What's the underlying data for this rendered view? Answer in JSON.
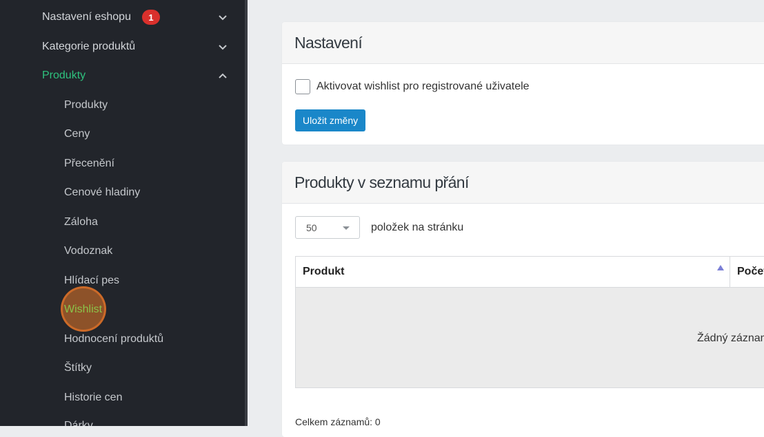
{
  "sidebar": {
    "top_items": [
      {
        "label": "Nastavení eshopu",
        "badge": "1"
      },
      {
        "label": "Kategorie produktů"
      },
      {
        "label": "Produkty"
      }
    ],
    "sub_items": [
      "Produkty",
      "Ceny",
      "Přecenění",
      "Cenové hladiny",
      "Záloha",
      "Vodoznak",
      "Hlídací pes",
      "Wishlist",
      "Hodnocení produktů",
      "Štítky",
      "Historie cen",
      "Dárky"
    ],
    "active_color": "#2ec27e",
    "badge_color": "#d9302c"
  },
  "settings_card": {
    "title": "Nastavení",
    "checkbox_label": "Aktivovat wishlist pro registrované uživatele",
    "checkbox_checked": false,
    "save_button": "Uložit změny",
    "button_color": "#1a87c9"
  },
  "wishlist_card": {
    "title": "Produkty v seznamu přání",
    "per_page_value": "50",
    "per_page_label": "položek na stránku",
    "columns": [
      "Produkt",
      "Počet"
    ],
    "empty_text": "Žádný záznam",
    "total": "Celkem záznamů: 0"
  }
}
